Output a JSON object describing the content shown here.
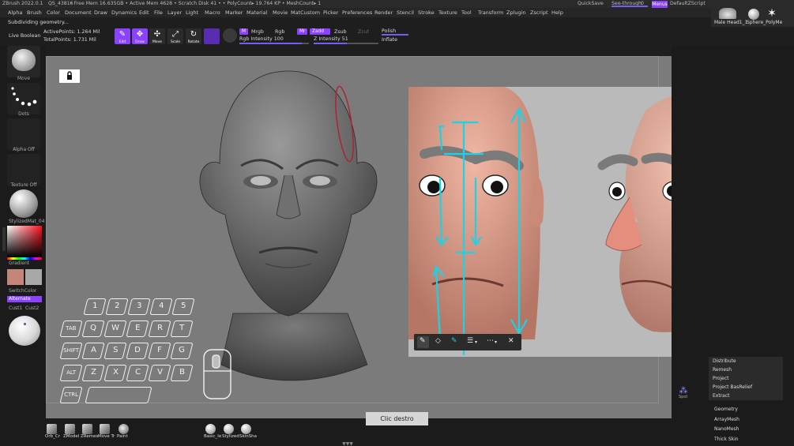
{
  "titlebar": {
    "app": "ZBrush 2022.0.1",
    "project": "QS_43816",
    "stats": "• Free Mem 16.635GB • Active Mem 4628 • Scratch Disk 41 • • PolyCount▸ 19.764 KP • MeshCount▸ 1",
    "quicksave": "QuickSave",
    "seethrough_label": "See-through",
    "seethrough_value": "0",
    "menus": "Menus",
    "script": "DefaultZScript"
  },
  "menubar": [
    "Alpha",
    "Brush",
    "Color",
    "Document",
    "Draw",
    "Dynamics",
    "Edit",
    "File",
    "Layer",
    "Light",
    "Macro",
    "Marker",
    "Material",
    "Movie",
    "MatCustom",
    "Picker",
    "Preferences",
    "Render",
    "Stencil",
    "Stroke",
    "Texture",
    "Tool",
    "Transform",
    "Zplugin",
    "Zscript",
    "Help"
  ],
  "status": {
    "message": "Subdividing geometry..."
  },
  "toolrow": {
    "live_boolean": "Live Boolean",
    "active_points": "ActivePoints: 1.264 Mil",
    "total_points": "TotalPoints: 1.731 Mil",
    "buttons": [
      {
        "label": "Edit",
        "glyph": "✎",
        "on": true
      },
      {
        "label": "Draw",
        "glyph": "✥",
        "on": true
      },
      {
        "label": "Move",
        "glyph": "✣",
        "on": false
      },
      {
        "label": "Scale",
        "glyph": "⤢",
        "on": false
      },
      {
        "label": "Rotate",
        "glyph": "↻",
        "on": false
      }
    ],
    "m": "M",
    "mrgb": "Mrgb",
    "rgb": "Rgb",
    "rgb_intensity_label": "Rgb Intensity",
    "rgb_intensity": "100",
    "rgb_intensity_fraction": 0.9,
    "zadd": "Zadd",
    "zsub": "Zsub",
    "zcut": "Zcut",
    "z_intensity_label": "Z Intensity",
    "z_intensity": "51",
    "z_intensity_fraction": 0.51,
    "polish": "Polish",
    "inflate": "Inflate"
  },
  "thumbs": {
    "tool": "Male Head1_1",
    "sphere": "Sphere_PolyMe"
  },
  "lefttray": {
    "move": "Move",
    "dots": "Dots",
    "alpha": "Alpha Off",
    "texture": "Texture Off",
    "material": "StylizedMat_04",
    "gradient": "Gradient",
    "switchcolor": "SwitchColor",
    "alternate": "Alternate",
    "cust1": "Cust1",
    "cust2": "Cust2",
    "main_color": "#c4867a",
    "secondary_color": "#a8a8a8"
  },
  "keyboard": {
    "row1": [
      "1",
      "2",
      "3",
      "4",
      "5"
    ],
    "row2": [
      "TAB",
      "Q",
      "W",
      "E",
      "R",
      "T"
    ],
    "row3": [
      "SHIFT",
      "A",
      "S",
      "D",
      "F",
      "G"
    ],
    "row4": [
      "ALT",
      "Z",
      "X",
      "C",
      "V",
      "B"
    ],
    "row5": [
      "CTRL"
    ]
  },
  "reference_toolbar": [
    "pen-icon",
    "eraser-icon",
    "highlighter-icon",
    "lines-icon",
    "grid-icon",
    "close-icon"
  ],
  "rightpanel": {
    "subtool_items": [
      "Distribute",
      "Remesh",
      "Project",
      "Project BasRelief",
      "Extract"
    ],
    "spotlight": "Spot",
    "sections": [
      "Geometry",
      "ArrayMesh",
      "NanoMesh",
      "Thick Skin"
    ]
  },
  "bottom": {
    "clic_destro": "Clic destro",
    "left_brushes": [
      "Orb_Cr",
      "ZModel",
      "ZRemes",
      "Move Tr",
      "Paint"
    ],
    "materials": [
      "Basic_le",
      "Stylized",
      "SkinSha"
    ]
  }
}
